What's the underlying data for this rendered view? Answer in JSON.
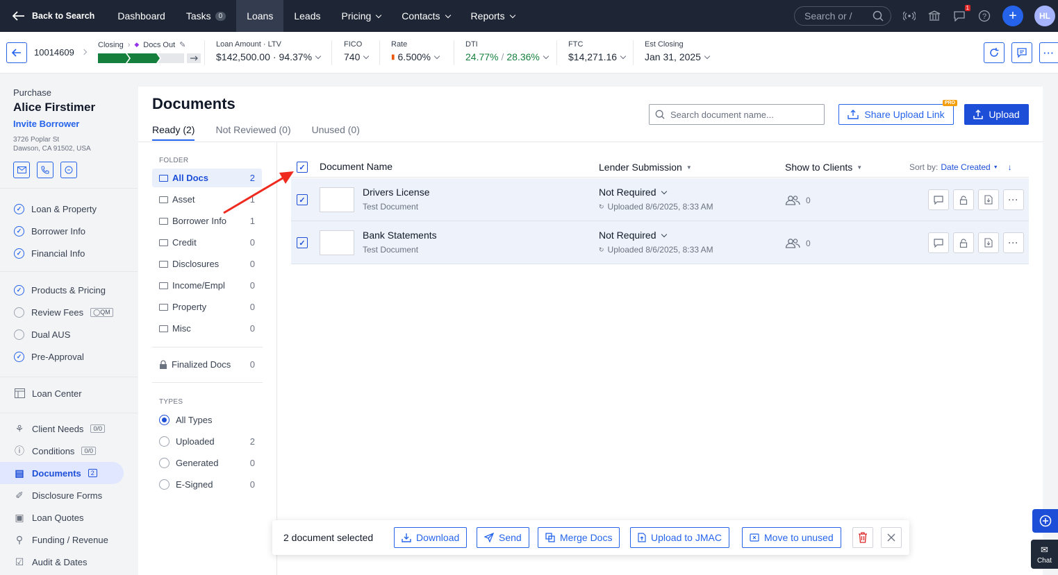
{
  "topnav": {
    "back_label": "Back to Search",
    "items": [
      {
        "label": "Dashboard"
      },
      {
        "label": "Tasks",
        "badge": "0"
      },
      {
        "label": "Loans",
        "active": true
      },
      {
        "label": "Leads"
      },
      {
        "label": "Pricing",
        "dropdown": true
      },
      {
        "label": "Contacts",
        "dropdown": true
      },
      {
        "label": "Reports",
        "dropdown": true
      }
    ],
    "search_placeholder": "Search or /",
    "notification_count": "1",
    "avatar_initials": "HL"
  },
  "loan_header": {
    "loan_id": "10014609",
    "stage_label": "Closing",
    "substage_label": "Docs Out",
    "loan_amount_label": "Loan Amount",
    "ltv_label": "LTV",
    "loan_amount": "$142,500.00",
    "ltv": "94.37%",
    "fico_label": "FICO",
    "fico": "740",
    "rate_label": "Rate",
    "rate": "6.500%",
    "dti_label": "DTI",
    "dti_front": "24.77%",
    "dti_back": "28.36%",
    "ftc_label": "FTC",
    "ftc": "$14,271.16",
    "est_closing_label": "Est Closing",
    "est_closing": "Jan 31, 2025"
  },
  "sidebar": {
    "loan_type": "Purchase",
    "borrower_name": "Alice Firstimer",
    "invite_label": "Invite Borrower",
    "address_line1": "3726 Poplar St",
    "address_line2": "Dawson, CA 91502, USA",
    "group1": [
      {
        "label": "Loan & Property",
        "done": true
      },
      {
        "label": "Borrower Info",
        "done": true
      },
      {
        "label": "Financial Info",
        "done": true
      }
    ],
    "group2": [
      {
        "label": "Products & Pricing",
        "done": true
      },
      {
        "label": "Review Fees",
        "done": false,
        "tag": "QM"
      },
      {
        "label": "Dual AUS",
        "done": false
      },
      {
        "label": "Pre-Approval",
        "done": true
      }
    ],
    "loan_center": "Loan Center",
    "group3": [
      {
        "label": "Client Needs",
        "tag": "0/0"
      },
      {
        "label": "Conditions",
        "tag": "0/0"
      },
      {
        "label": "Documents",
        "tag": "2",
        "active": true
      },
      {
        "label": "Disclosure Forms"
      },
      {
        "label": "Loan Quotes"
      },
      {
        "label": "Funding / Revenue"
      },
      {
        "label": "Audit & Dates"
      }
    ]
  },
  "documents": {
    "title": "Documents",
    "tabs": [
      {
        "label": "Ready (2)",
        "active": true
      },
      {
        "label": "Not Reviewed (0)"
      },
      {
        "label": "Unused (0)"
      }
    ],
    "search_placeholder": "Search document name...",
    "share_label": "Share Upload Link",
    "pro_label": "PRO",
    "upload_label": "Upload",
    "folder_section": "FOLDER",
    "folders": [
      {
        "name": "All Docs",
        "count": "2",
        "active": true
      },
      {
        "name": "Asset",
        "count": "1"
      },
      {
        "name": "Borrower Info",
        "count": "1"
      },
      {
        "name": "Credit",
        "count": "0"
      },
      {
        "name": "Disclosures",
        "count": "0"
      },
      {
        "name": "Income/Empl",
        "count": "0"
      },
      {
        "name": "Property",
        "count": "0"
      },
      {
        "name": "Misc",
        "count": "0"
      }
    ],
    "finalized": {
      "name": "Finalized Docs",
      "count": "0"
    },
    "types_section": "TYPES",
    "types": [
      {
        "name": "All Types",
        "count": "",
        "selected": true
      },
      {
        "name": "Uploaded",
        "count": "2"
      },
      {
        "name": "Generated",
        "count": "0"
      },
      {
        "name": "E-Signed",
        "count": "0"
      }
    ],
    "columns": {
      "name": "Document Name",
      "lender": "Lender Submission",
      "clients": "Show to Clients",
      "sort_label": "Sort by:",
      "sort_value": "Date Created"
    },
    "rows": [
      {
        "name": "Drivers License",
        "sub": "Test Document",
        "lender_status": "Not Required",
        "uploaded": "Uploaded 8/6/2025, 8:33 AM",
        "clients": "0",
        "checked": true
      },
      {
        "name": "Bank Statements",
        "sub": "Test Document",
        "lender_status": "Not Required",
        "uploaded": "Uploaded 8/6/2025, 8:33 AM",
        "clients": "0",
        "checked": true
      }
    ]
  },
  "bulk": {
    "selected_label": "2 document selected",
    "download": "Download",
    "send": "Send",
    "merge": "Merge Docs",
    "upload_jmac": "Upload to JMAC",
    "move_unused": "Move to unused"
  },
  "chat_label": "Chat",
  "colors": {
    "nav_bg": "#1e2535",
    "accent": "#2563eb",
    "progress_green": "#15803d",
    "dti_green": "#15803d",
    "annotation_arrow": "#ef2b1f"
  }
}
